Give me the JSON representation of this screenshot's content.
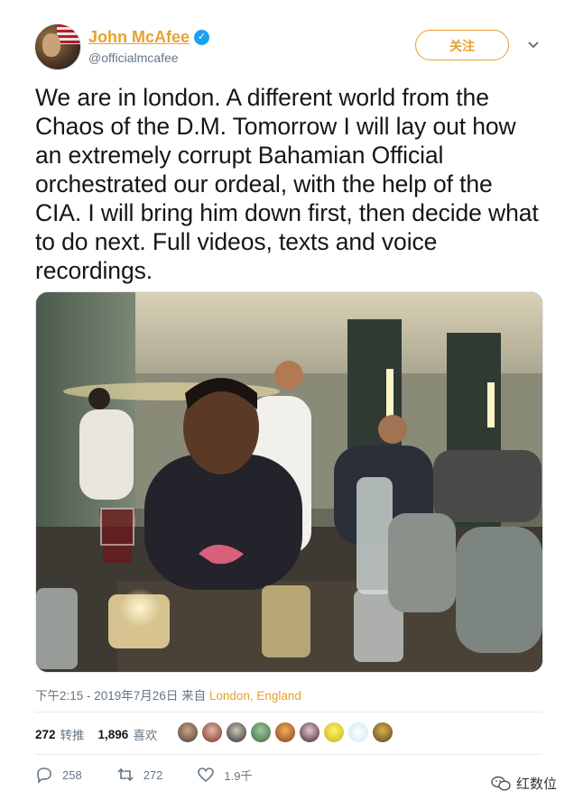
{
  "author": {
    "name": "John McAfee",
    "handle": "@officialmcafee",
    "verified_icon": "verified-badge-icon",
    "avatar_icon": "user-avatar"
  },
  "header": {
    "follow_label": "关注",
    "more_icon": "chevron-down-icon"
  },
  "tweet": {
    "text": "We are in london. A different world from the Chaos of the D.M. Tomorrow I will lay out how an extremely corrupt Bahamian Official orchestrated our ordeal, with the help of the CIA. I will bring him down first, then decide what to do next. Full videos, texts and voice recordings.",
    "timestamp": "下午2:15 - 2019年7月26日 来自 ",
    "location": "London, England"
  },
  "stats": {
    "retweets_count": "272",
    "retweets_label": "转推",
    "likes_count": "1,896",
    "likes_label": "喜欢"
  },
  "actions": {
    "reply_count": "258",
    "retweet_count": "272",
    "like_count": "1.9千"
  },
  "watermark": {
    "label": "红数位"
  },
  "colors": {
    "accent": "#e8a12c",
    "verified": "#1da1f2",
    "muted": "#657786",
    "text": "#14171a"
  }
}
